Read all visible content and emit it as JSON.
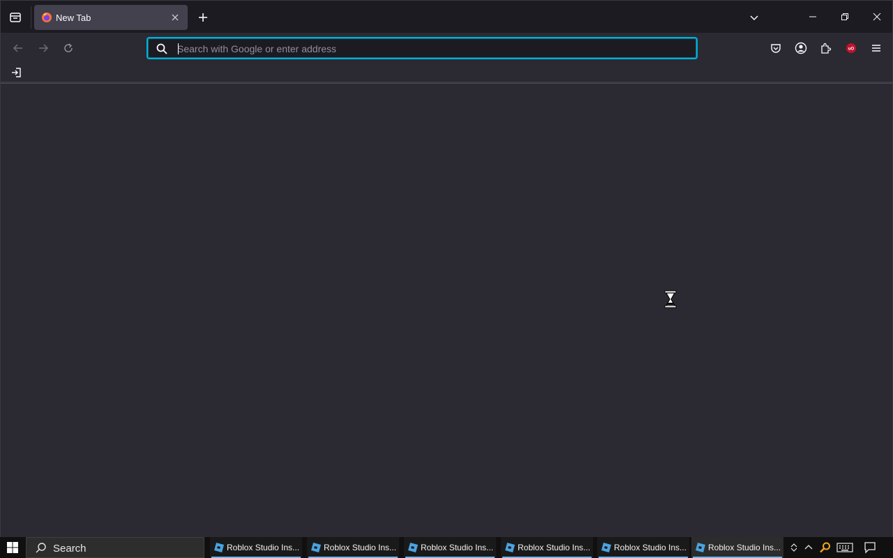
{
  "browser": {
    "tab": {
      "title": "New Tab"
    },
    "urlbar": {
      "placeholder": "Search with Google or enter address",
      "value": ""
    },
    "colors": {
      "focus_ring": "#00b3d9",
      "extension_badge": "#c0132e"
    }
  },
  "taskbar": {
    "search_label": "Search",
    "apps": [
      {
        "label": "Roblox Studio Ins..."
      },
      {
        "label": "Roblox Studio Ins..."
      },
      {
        "label": "Roblox Studio Ins..."
      },
      {
        "label": "Roblox Studio Ins..."
      },
      {
        "label": "Roblox Studio Ins..."
      },
      {
        "label": "Roblox Studio Ins..."
      }
    ],
    "active_app_index": 5
  }
}
